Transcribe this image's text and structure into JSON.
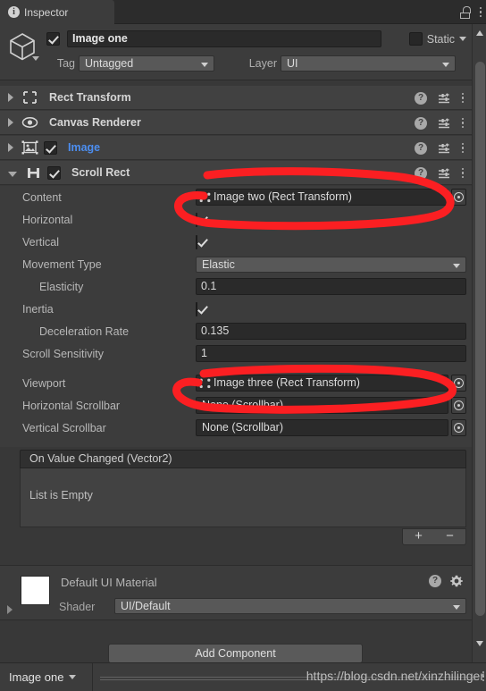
{
  "window": {
    "tab_label": "Inspector",
    "info_icon": "info-icon",
    "lock_icon": "lock-icon",
    "menu_icon": "kebab-menu-icon"
  },
  "header": {
    "enabled": true,
    "object_name": "Image one",
    "static_label": "Static",
    "static_checked": false,
    "tag_label": "Tag",
    "tag_value": "Untagged",
    "layer_label": "Layer",
    "layer_value": "UI"
  },
  "components": [
    {
      "name": "Rect Transform",
      "icon": "rect-transform-icon",
      "expanded": false,
      "has_checkbox": false,
      "checked": false,
      "link": false
    },
    {
      "name": "Canvas Renderer",
      "icon": "eye-icon",
      "expanded": false,
      "has_checkbox": false,
      "checked": false,
      "link": false
    },
    {
      "name": "Image",
      "icon": "image-component-icon",
      "expanded": false,
      "has_checkbox": true,
      "checked": true,
      "link": true
    },
    {
      "name": "Scroll Rect",
      "icon": "scroll-rect-icon",
      "expanded": true,
      "has_checkbox": true,
      "checked": true,
      "link": false
    }
  ],
  "scroll_rect": {
    "content": {
      "label": "Content",
      "value": "Image two (Rect Transform)",
      "type": "object"
    },
    "horizontal": {
      "label": "Horizontal",
      "value": true,
      "type": "bool"
    },
    "vertical": {
      "label": "Vertical",
      "value": true,
      "type": "bool"
    },
    "movement_type": {
      "label": "Movement Type",
      "value": "Elastic",
      "type": "enum"
    },
    "elasticity": {
      "label": "Elasticity",
      "value": "0.1",
      "type": "number"
    },
    "inertia": {
      "label": "Inertia",
      "value": true,
      "type": "bool"
    },
    "deceleration_rate": {
      "label": "Deceleration Rate",
      "value": "0.135",
      "type": "number"
    },
    "scroll_sensitivity": {
      "label": "Scroll Sensitivity",
      "value": "1",
      "type": "number"
    },
    "viewport": {
      "label": "Viewport",
      "value": "Image three (Rect Transform)",
      "type": "object"
    },
    "horizontal_scrollbar": {
      "label": "Horizontal Scrollbar",
      "value": "None (Scrollbar)",
      "type": "object"
    },
    "vertical_scrollbar": {
      "label": "Vertical Scrollbar",
      "value": "None (Scrollbar)",
      "type": "object"
    },
    "event": {
      "header": "On Value Changed (Vector2)",
      "empty_text": "List is Empty",
      "add_label": "+",
      "remove_label": "−"
    }
  },
  "material": {
    "title": "Default UI Material",
    "shader_label": "Shader",
    "shader_value": "UI/Default",
    "swatch_color": "#ffffff",
    "help_icon": "help-icon",
    "gear_icon": "gear-icon"
  },
  "footer": {
    "add_component_label": "Add Component",
    "breadcrumb": "Image one",
    "watermark": "https://blog.csdn.net/xinzhilinger"
  },
  "annotations": {
    "color": "#fb1f22",
    "circles": [
      {
        "name": "content-field-highlight",
        "target": "Content"
      },
      {
        "name": "viewport-field-highlight",
        "target": "Viewport"
      }
    ]
  },
  "icons": {
    "help": "?",
    "preset": "preset-icon",
    "row_menu": "kebab-menu-icon",
    "object_picker": "object-picker-icon"
  }
}
